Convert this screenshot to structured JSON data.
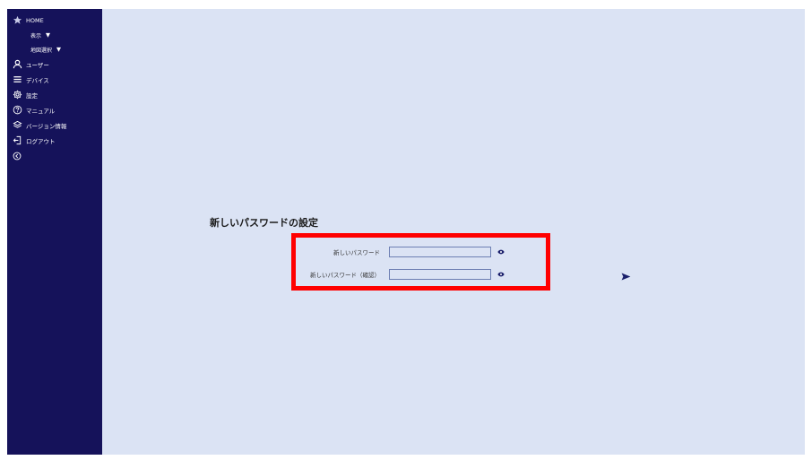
{
  "sidebar": {
    "home_label": "HOME",
    "display_label": "表示",
    "display_caret": "▼",
    "map_select_label": "地図選択",
    "map_select_caret": "▼",
    "user_label": "ユーザー",
    "devices_label": "デバイス",
    "settings_label": "設定",
    "manual_label": "マニュアル",
    "version_label": "バージョン情報",
    "logout_label": "ログアウト"
  },
  "main": {
    "title": "新しいパスワードの設定",
    "new_password_label": "新しいパスワード",
    "new_password_value": "",
    "confirm_password_label": "新しいパスワード（確認）",
    "confirm_password_value": ""
  },
  "colors": {
    "sidebar_bg": "#15125a",
    "main_bg": "#dbe3f4",
    "highlight": "#ff0000",
    "accent": "#1a1f6b"
  },
  "icons": {
    "home": "star-icon",
    "user": "user-icon",
    "devices": "list-icon",
    "settings": "gear-icon",
    "manual": "help-icon",
    "version": "layers-icon",
    "logout": "logout-icon",
    "collapse": "collapse-icon",
    "show_password": "eye-icon",
    "submit": "send-arrow-icon"
  }
}
